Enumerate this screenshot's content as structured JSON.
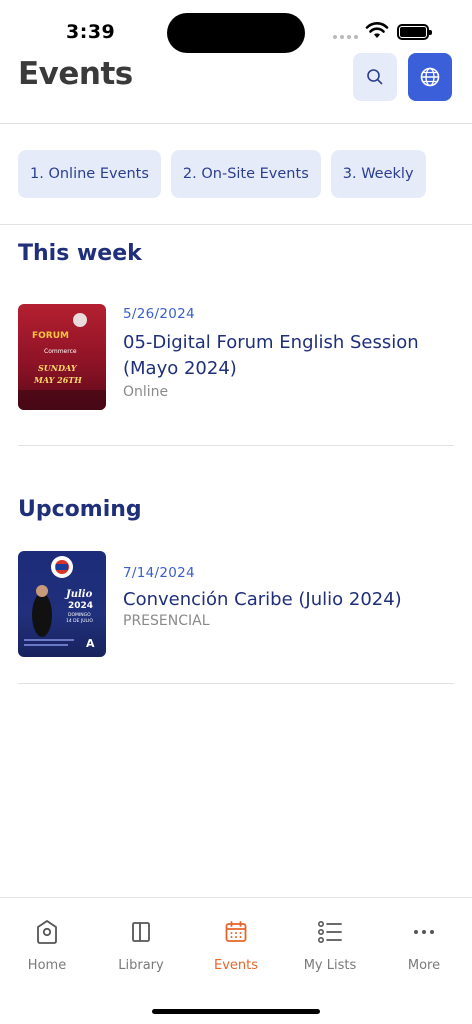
{
  "status_bar": {
    "time": "3:39"
  },
  "header": {
    "title": "Events",
    "search_icon": "search-icon",
    "globe_icon": "globe-icon"
  },
  "tabs": [
    {
      "label": "1. Online Events"
    },
    {
      "label": "2. On-Site Events"
    },
    {
      "label": "3. Weekly"
    }
  ],
  "sections": [
    {
      "title": "This week",
      "events": [
        {
          "date": "5/26/2024",
          "title": "05-Digital Forum English Session (Mayo 2024)",
          "location": "Online",
          "thumb_lines": [
            "FORUM",
            "Commerce",
            "SUNDAY",
            "MAY 26TH"
          ]
        }
      ]
    },
    {
      "title": "Upcoming",
      "events": [
        {
          "date": "7/14/2024",
          "title": "Convención Caribe (Julio 2024)",
          "location": "PRESENCIAL",
          "thumb_lines": [
            "Julio",
            "2024",
            "DOMINGO",
            "14 DE JULIO"
          ]
        }
      ]
    }
  ],
  "bottom_nav": [
    {
      "label": "Home",
      "icon": "home-icon",
      "active": false
    },
    {
      "label": "Library",
      "icon": "library-icon",
      "active": false
    },
    {
      "label": "Events",
      "icon": "calendar-icon",
      "active": true
    },
    {
      "label": "My Lists",
      "icon": "list-icon",
      "active": false
    },
    {
      "label": "More",
      "icon": "more-icon",
      "active": false
    }
  ],
  "colors": {
    "accent": "#3b5fd9",
    "nav_active": "#e4662a",
    "title": "#1f2f7a"
  }
}
